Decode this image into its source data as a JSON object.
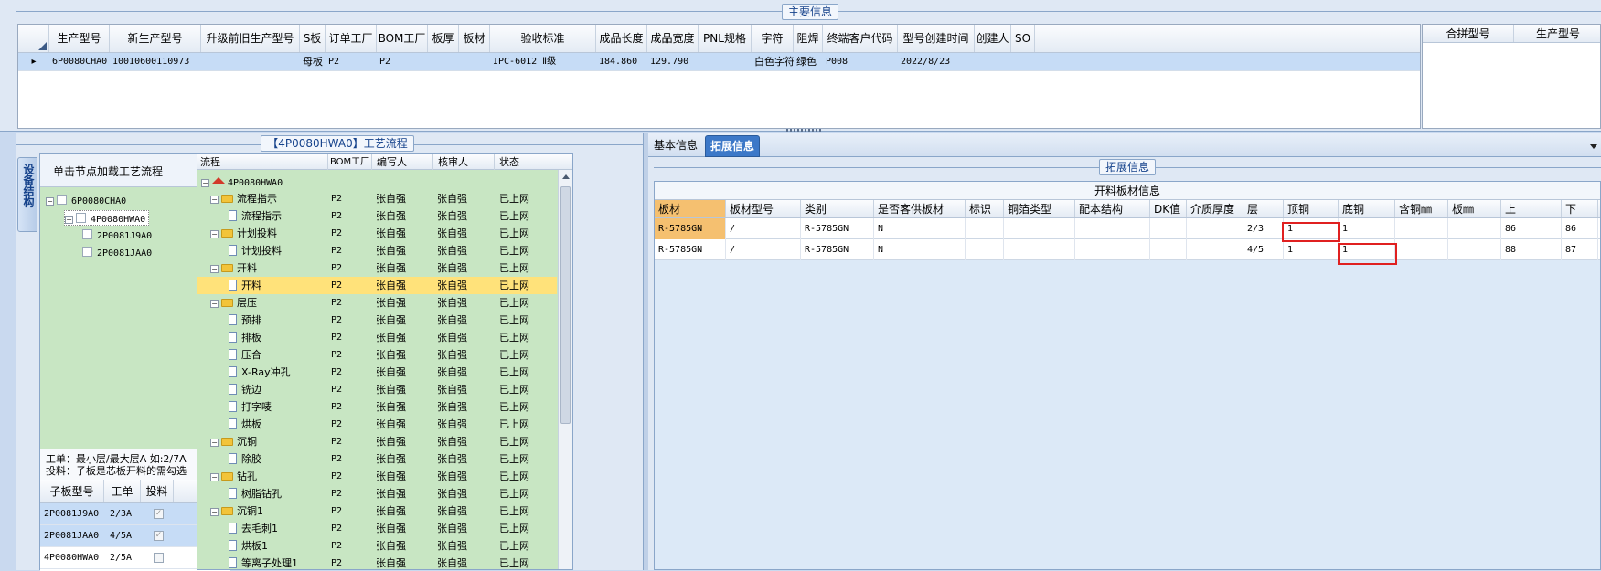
{
  "main_info": {
    "title": "主要信息",
    "columns": [
      "生产型号",
      "新生产型号",
      "升级前旧生产型号",
      "S板",
      "订单工厂",
      "BOM工厂",
      "板厚",
      "板材",
      "验收标准",
      "成品长度",
      "成品宽度",
      "PNL规格",
      "字符",
      "阻焊",
      "终端客户代码",
      "型号创建时间",
      "创建人",
      "SO"
    ],
    "row": [
      "6P0080CHA0",
      "10010600110973",
      "",
      "母板",
      "P2",
      "P2",
      "",
      "",
      "IPC-6012 Ⅱ级",
      "184.860",
      "129.790",
      "",
      "白色字符",
      "绿色",
      "P008",
      "2022/8/23",
      "",
      ""
    ],
    "row_marker": "▸",
    "side_columns": [
      "合拼型号",
      "生产型号"
    ]
  },
  "process": {
    "title": "【4P0080HWA0】工艺流程",
    "side_tab": "设备结构",
    "load_hint": "单击节点加载工艺流程",
    "model_tree": [
      {
        "label": "6P0080CHA0",
        "level": 0
      },
      {
        "label": "4P0080HWA0",
        "level": 1
      },
      {
        "label": "2P0081J9A0",
        "level": 2
      },
      {
        "label": "2P0081JAA0",
        "level": 2
      }
    ],
    "note_line1": "工单：最小层/最大层A 如:2/7A",
    "note_line2": "投料：子板是芯板开料的需勾选",
    "sub_table": {
      "headers": [
        "子板型号",
        "工单",
        "投料"
      ],
      "rows": [
        {
          "model": "2P0081J9A0",
          "order": "2/3A",
          "checked": true
        },
        {
          "model": "2P0081JAA0",
          "order": "4/5A",
          "checked": true
        },
        {
          "model": "4P0080HWA0",
          "order": "2/5A",
          "checked": false
        }
      ],
      "check_mark": "✓"
    },
    "flow_headers": [
      "流程",
      "BOM工厂",
      "编写人",
      "核审人",
      "状态"
    ],
    "root_node": "4P0080HWA0",
    "flow_rows": [
      {
        "name": "流程指示",
        "group": true,
        "bom": "P2",
        "writer": "张自强",
        "reviewer": "张自强",
        "status": "已上网"
      },
      {
        "name": "流程指示",
        "group": false,
        "bom": "P2",
        "writer": "张自强",
        "reviewer": "张自强",
        "status": "已上网"
      },
      {
        "name": "计划投料",
        "group": true,
        "bom": "P2",
        "writer": "张自强",
        "reviewer": "张自强",
        "status": "已上网"
      },
      {
        "name": "计划投料",
        "group": false,
        "bom": "P2",
        "writer": "张自强",
        "reviewer": "张自强",
        "status": "已上网"
      },
      {
        "name": "开料",
        "group": true,
        "bom": "P2",
        "writer": "张自强",
        "reviewer": "张自强",
        "status": "已上网"
      },
      {
        "name": "开料",
        "group": false,
        "bom": "P2",
        "writer": "张自强",
        "reviewer": "张自强",
        "status": "已上网",
        "selected": true
      },
      {
        "name": "层压",
        "group": true,
        "bom": "P2",
        "writer": "张自强",
        "reviewer": "张自强",
        "status": "已上网"
      },
      {
        "name": "预排",
        "group": false,
        "bom": "P2",
        "writer": "张自强",
        "reviewer": "张自强",
        "status": "已上网"
      },
      {
        "name": "排板",
        "group": false,
        "bom": "P2",
        "writer": "张自强",
        "reviewer": "张自强",
        "status": "已上网"
      },
      {
        "name": "压合",
        "group": false,
        "bom": "P2",
        "writer": "张自强",
        "reviewer": "张自强",
        "status": "已上网"
      },
      {
        "name": "X-Ray冲孔",
        "group": false,
        "bom": "P2",
        "writer": "张自强",
        "reviewer": "张自强",
        "status": "已上网"
      },
      {
        "name": "铣边",
        "group": false,
        "bom": "P2",
        "writer": "张自强",
        "reviewer": "张自强",
        "status": "已上网"
      },
      {
        "name": "打字唛",
        "group": false,
        "bom": "P2",
        "writer": "张自强",
        "reviewer": "张自强",
        "status": "已上网"
      },
      {
        "name": "烘板",
        "group": false,
        "bom": "P2",
        "writer": "张自强",
        "reviewer": "张自强",
        "status": "已上网"
      },
      {
        "name": "沉铜",
        "group": true,
        "bom": "P2",
        "writer": "张自强",
        "reviewer": "张自强",
        "status": "已上网"
      },
      {
        "name": "除胶",
        "group": false,
        "bom": "P2",
        "writer": "张自强",
        "reviewer": "张自强",
        "status": "已上网"
      },
      {
        "name": "钻孔",
        "group": true,
        "bom": "P2",
        "writer": "张自强",
        "reviewer": "张自强",
        "status": "已上网"
      },
      {
        "name": "树脂钻孔",
        "group": false,
        "bom": "P2",
        "writer": "张自强",
        "reviewer": "张自强",
        "status": "已上网"
      },
      {
        "name": "沉铜1",
        "group": true,
        "bom": "P2",
        "writer": "张自强",
        "reviewer": "张自强",
        "status": "已上网"
      },
      {
        "name": "去毛刺1",
        "group": false,
        "bom": "P2",
        "writer": "张自强",
        "reviewer": "张自强",
        "status": "已上网"
      },
      {
        "name": "烘板1",
        "group": false,
        "bom": "P2",
        "writer": "张自强",
        "reviewer": "张自强",
        "status": "已上网"
      },
      {
        "name": "等离子处理1",
        "group": false,
        "bom": "P2",
        "writer": "张自强",
        "reviewer": "张自强",
        "status": "已上网"
      }
    ]
  },
  "right": {
    "tabs": [
      "基本信息",
      "拓展信息"
    ],
    "active_tab": "拓展信息",
    "group_title": "拓展信息",
    "table_title": "开料板材信息",
    "headers": [
      "板材",
      "板材型号",
      "类别",
      "是否客供板材",
      "标识",
      "铜箔类型",
      "配本结构",
      "DK值",
      "介质厚度",
      "层",
      "顶铜",
      "底铜",
      "含铜㎜",
      "板㎜",
      "上",
      "下"
    ],
    "rows": [
      [
        "R-5785GN",
        "/",
        "R-5785GN",
        "N",
        "",
        "",
        "",
        "",
        "",
        "2/3",
        "1",
        "1",
        "",
        "",
        "86",
        "86"
      ],
      [
        "R-5785GN",
        "/",
        "R-5785GN",
        "N",
        "",
        "",
        "",
        "",
        "",
        "4/5",
        "1",
        "1",
        "",
        "",
        "88",
        "87"
      ]
    ]
  },
  "colors": {
    "highlight": "#c6dcf6",
    "selected": "#ffe27a",
    "tree_bg": "#c8e6c3",
    "red": "#e02020",
    "accent": "#3c78c8"
  }
}
